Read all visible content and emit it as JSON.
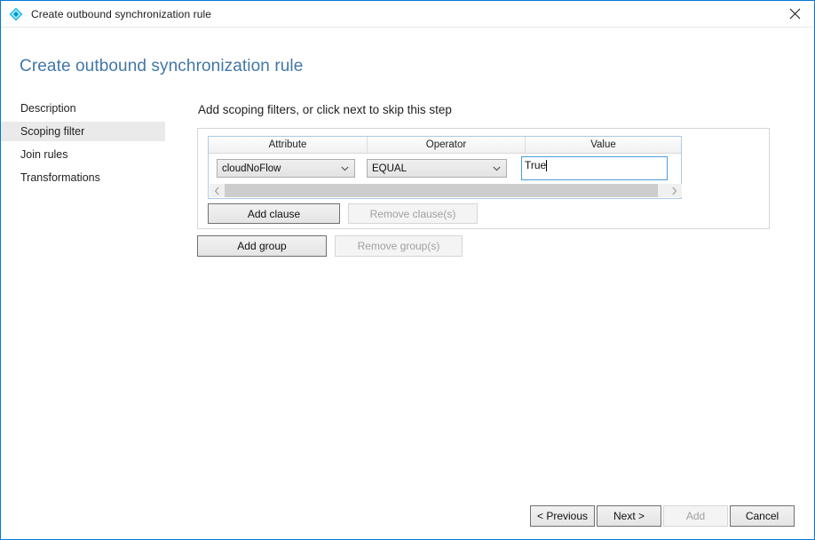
{
  "window": {
    "titlebar": {
      "icon": "diamond-sync-icon",
      "title": "Create outbound synchronization rule",
      "close_label": "✕"
    },
    "heading": "Create outbound synchronization rule"
  },
  "nav": {
    "items": [
      {
        "label": "Description",
        "selected": false
      },
      {
        "label": "Scoping filter",
        "selected": true
      },
      {
        "label": "Join rules",
        "selected": false
      },
      {
        "label": "Transformations",
        "selected": false
      }
    ]
  },
  "main": {
    "instruction": "Add scoping filters, or click next to skip this step",
    "grid": {
      "columns": [
        "Attribute",
        "Operator",
        "Value"
      ],
      "rows": [
        {
          "attribute": "cloudNoFlow",
          "operator": "EQUAL",
          "value": "True"
        }
      ],
      "scrollbar": {
        "left_arrow": "‹",
        "right_arrow": "›"
      }
    },
    "clause_buttons": {
      "add": "Add clause",
      "remove": "Remove clause(s)",
      "remove_disabled": true
    },
    "group_buttons": {
      "add": "Add group",
      "remove": "Remove group(s)",
      "remove_disabled": true
    }
  },
  "footer": {
    "previous": "< Previous",
    "next": "Next >",
    "add": "Add",
    "cancel": "Cancel",
    "add_disabled": true
  },
  "colors": {
    "window_border": "#0078d7",
    "heading": "#4277a8",
    "nav_selected_bg": "#eaeaea",
    "focus_border": "#4a9ddc",
    "icon_cyan": "#00b0f0"
  }
}
